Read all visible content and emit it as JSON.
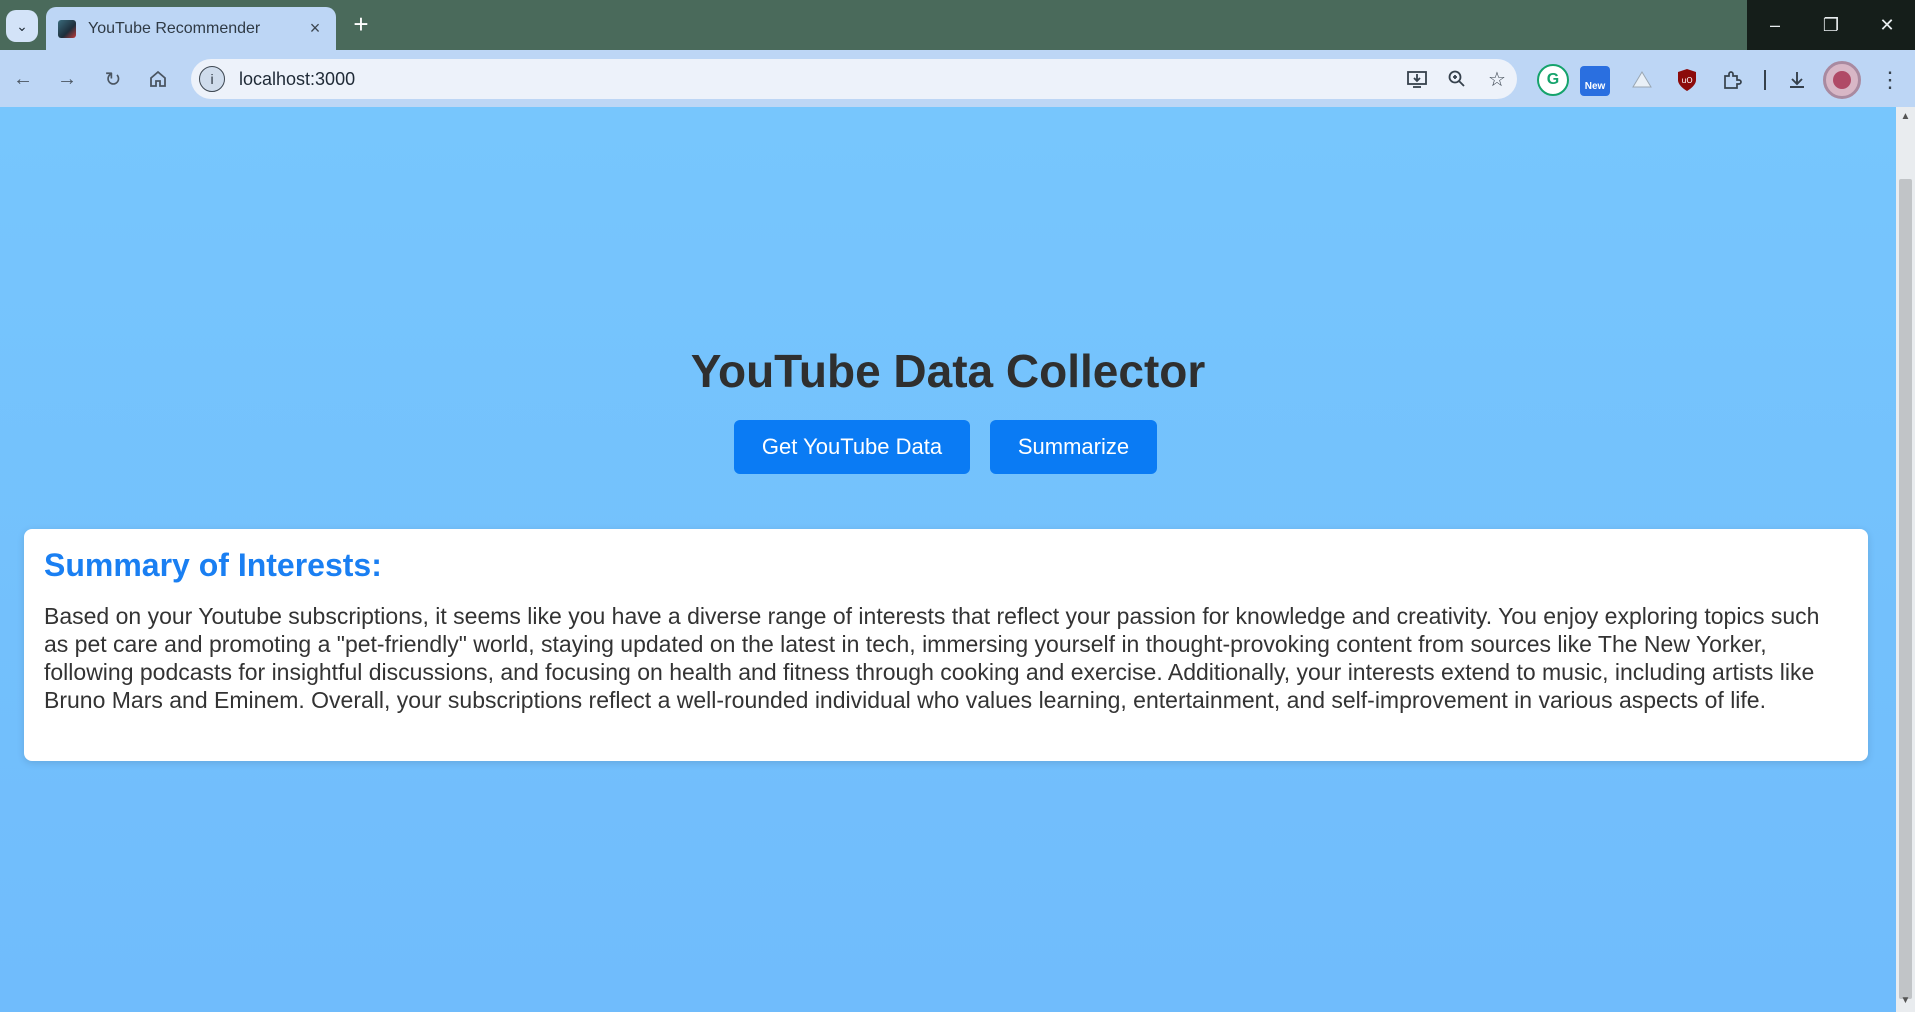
{
  "browser": {
    "tab_title": "YouTube Recommender",
    "tab_close": "×",
    "new_tab": "+",
    "url": "localhost:3000",
    "extension_badge": "New",
    "window_controls": {
      "minimize": "–",
      "restore": "❐",
      "close": "✕"
    }
  },
  "page": {
    "title": "YouTube Data Collector",
    "buttons": {
      "get_data": "Get YouTube Data",
      "summarize": "Summarize"
    },
    "summary": {
      "heading": "Summary of Interests:",
      "text": "Based on your Youtube subscriptions, it seems like you have a diverse range of interests that reflect your passion for knowledge and creativity. You enjoy exploring topics such as pet care and promoting a \"pet-friendly\" world, staying updated on the latest in tech, immersing yourself in thought-provoking content from sources like The New Yorker, following podcasts for insightful discussions, and focusing on health and fitness through cooking and exercise. Additionally, your interests extend to music, including artists like Bruno Mars and Eminem. Overall, your subscriptions reflect a well-rounded individual who values learning, entertainment, and self-improvement in various aspects of life."
    }
  },
  "colors": {
    "page_background": "#75c2fd",
    "button": "#0a7bf4",
    "summary_heading": "#1a7ff2"
  }
}
